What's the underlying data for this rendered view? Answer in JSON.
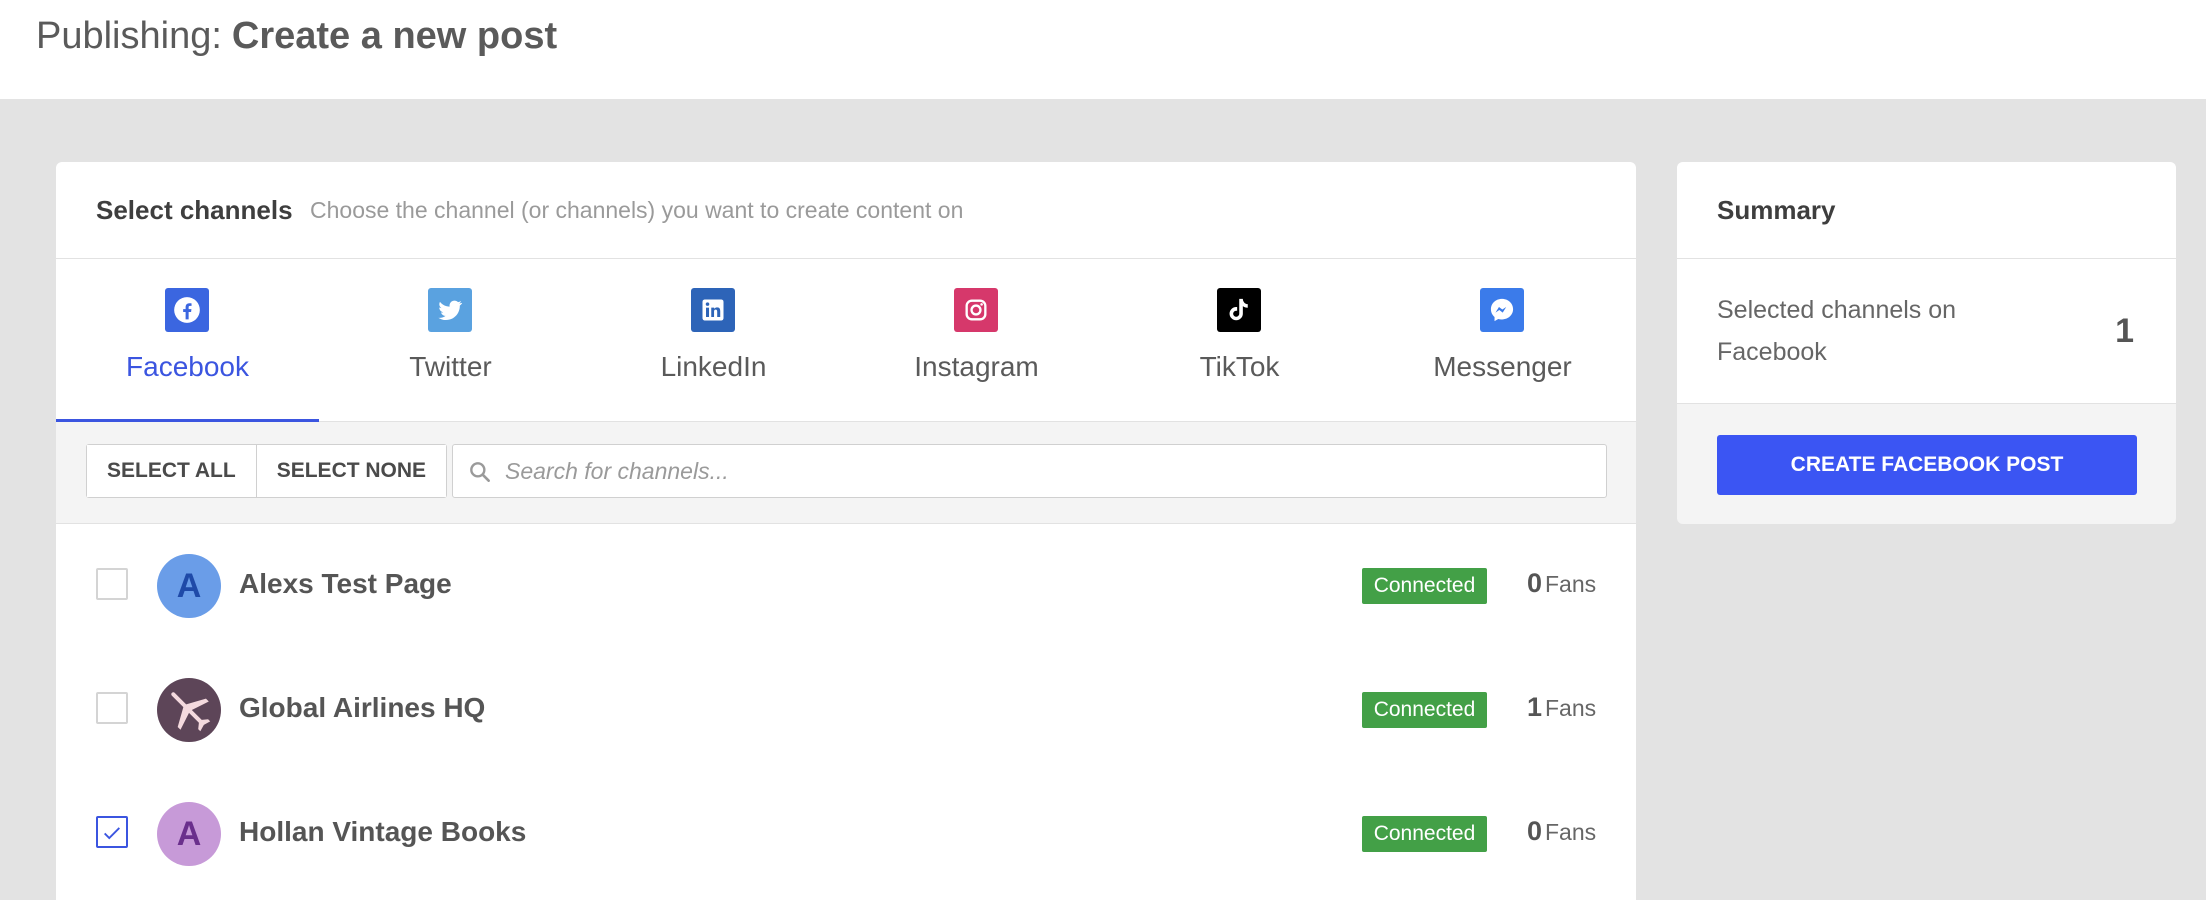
{
  "header": {
    "prefix": "Publishing:",
    "title": "Create a new post"
  },
  "channels_card": {
    "title": "Select channels",
    "subtitle": "Choose the channel (or channels) you want to create content on"
  },
  "tabs": [
    {
      "label": "Facebook",
      "icon": "facebook-icon",
      "color": "#3b66e0",
      "active": true
    },
    {
      "label": "Twitter",
      "icon": "twitter-icon",
      "color": "#5aa2e0",
      "active": false
    },
    {
      "label": "LinkedIn",
      "icon": "linkedin-icon",
      "color": "#2d64b8",
      "active": false
    },
    {
      "label": "Instagram",
      "icon": "instagram-icon",
      "color": "#d6386b",
      "active": false
    },
    {
      "label": "TikTok",
      "icon": "tiktok-icon",
      "color": "#000000",
      "active": false
    },
    {
      "label": "Messenger",
      "icon": "messenger-icon",
      "color": "#3b7bea",
      "active": false
    }
  ],
  "toolbar": {
    "select_all": "SELECT ALL",
    "select_none": "SELECT NONE",
    "search_placeholder": "Search for channels..."
  },
  "rows": [
    {
      "name": "Alexs Test Page",
      "avatar_letter": "A",
      "avatar_bg": "#6a9de8",
      "avatar_fg": "#1f4aa8",
      "status": "Connected",
      "fans": "0",
      "fans_label": "Fans",
      "checked": false
    },
    {
      "name": "Global Airlines HQ",
      "avatar_letter": "",
      "avatar_bg": "#5d4558",
      "avatar_fg": "#ffffff",
      "status": "Connected",
      "fans": "1",
      "fans_label": "Fans",
      "checked": false
    },
    {
      "name": "Hollan Vintage Books",
      "avatar_letter": "A",
      "avatar_bg": "#c79ad8",
      "avatar_fg": "#6a2f8c",
      "status": "Connected",
      "fans": "0",
      "fans_label": "Fans",
      "checked": true
    }
  ],
  "summary": {
    "title": "Summary",
    "label": "Selected channels on Facebook",
    "count": "1",
    "button": "CREATE FACEBOOK POST"
  },
  "colors": {
    "accent": "#3b55e0",
    "button": "#3b55f3",
    "connected": "#43a047"
  }
}
